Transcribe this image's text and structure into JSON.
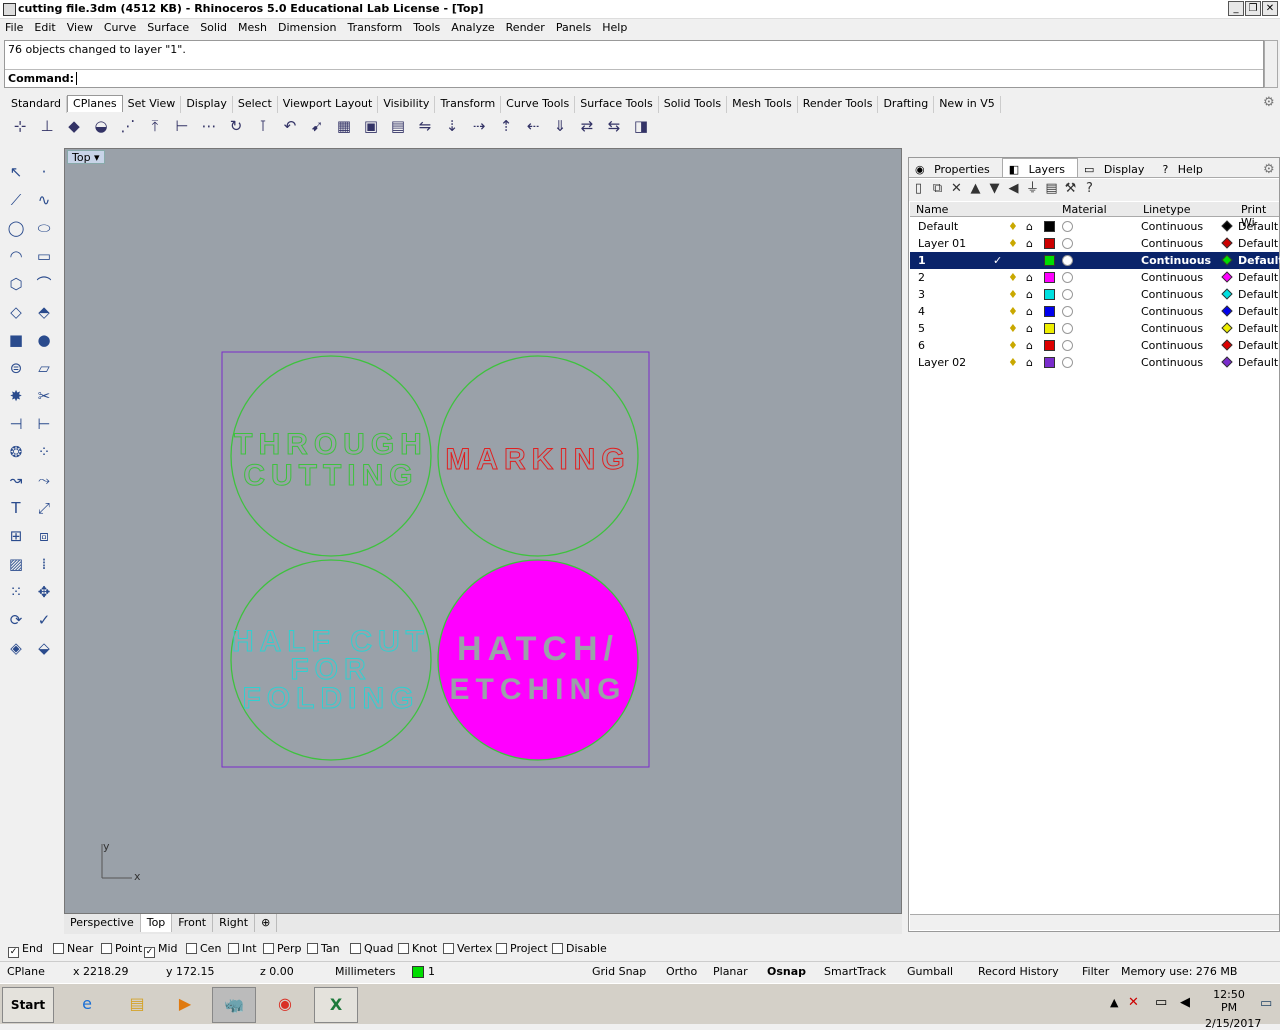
{
  "window": {
    "title": "cutting file.3dm (4512 KB) - Rhinoceros 5.0 Educational Lab License - [Top]"
  },
  "menu": [
    "File",
    "Edit",
    "View",
    "Curve",
    "Surface",
    "Solid",
    "Mesh",
    "Dimension",
    "Transform",
    "Tools",
    "Analyze",
    "Render",
    "Panels",
    "Help"
  ],
  "command": {
    "history": "76 objects changed to layer \"1\".",
    "prompt": "Command:"
  },
  "toolbar_tabs": [
    "Standard",
    "CPlanes",
    "Set View",
    "Display",
    "Select",
    "Viewport Layout",
    "Visibility",
    "Transform",
    "Curve Tools",
    "Surface Tools",
    "Solid Tools",
    "Mesh Tools",
    "Render Tools",
    "Drafting",
    "New in V5"
  ],
  "viewport": {
    "label": "Top",
    "axis_y": "y",
    "axis_x": "x",
    "texts": {
      "through1": "THROUGH",
      "through2": "CUTTING",
      "marking": "MARKING",
      "half1": "HALF CUT",
      "half2": "FOR",
      "half3": "FOLDING",
      "hatch1": "HATCH/",
      "hatch2": "ETCHING"
    },
    "colors": {
      "green": "#3ec23e",
      "red": "#e02020",
      "cyan": "#30d0d0",
      "magenta": "#ff00ff",
      "purple": "#7a2ccc"
    }
  },
  "viewport_tabs": [
    "Perspective",
    "Top",
    "Front",
    "Right"
  ],
  "panel": {
    "tabs": [
      "Properties",
      "Layers",
      "Display",
      "Help"
    ],
    "columns": {
      "name": "Name",
      "material": "Material",
      "linetype": "Linetype",
      "print": "Print Wi"
    },
    "layers": [
      {
        "name": "Default",
        "color": "#000000",
        "linetype": "Continuous",
        "print": "Default",
        "current": false
      },
      {
        "name": "Layer 01",
        "color": "#cc0000",
        "linetype": "Continuous",
        "print": "Default",
        "current": false
      },
      {
        "name": "1",
        "color": "#00dd00",
        "linetype": "Continuous",
        "print": "Default",
        "current": true
      },
      {
        "name": "2",
        "color": "#ff00ff",
        "linetype": "Continuous",
        "print": "Default",
        "current": false
      },
      {
        "name": "3",
        "color": "#00e0e0",
        "linetype": "Continuous",
        "print": "Default",
        "current": false
      },
      {
        "name": "4",
        "color": "#0000ee",
        "linetype": "Continuous",
        "print": "Default",
        "current": false
      },
      {
        "name": "5",
        "color": "#eeee00",
        "linetype": "Continuous",
        "print": "Default",
        "current": false
      },
      {
        "name": "6",
        "color": "#dd0000",
        "linetype": "Continuous",
        "print": "Default",
        "current": false
      },
      {
        "name": "Layer 02",
        "color": "#7a2ccc",
        "linetype": "Continuous",
        "print": "Default",
        "current": false
      }
    ]
  },
  "osnap": [
    {
      "label": "End",
      "checked": true
    },
    {
      "label": "Near",
      "checked": false
    },
    {
      "label": "Point",
      "checked": false
    },
    {
      "label": "Mid",
      "checked": true
    },
    {
      "label": "Cen",
      "checked": false
    },
    {
      "label": "Int",
      "checked": false
    },
    {
      "label": "Perp",
      "checked": false
    },
    {
      "label": "Tan",
      "checked": false
    },
    {
      "label": "Quad",
      "checked": false
    },
    {
      "label": "Knot",
      "checked": false
    },
    {
      "label": "Vertex",
      "checked": false
    },
    {
      "label": "Project",
      "checked": false
    },
    {
      "label": "Disable",
      "checked": false
    }
  ],
  "status": {
    "cplane": "CPlane",
    "x": "x 2218.29",
    "y": "y 172.15",
    "z": "z 0.00",
    "units": "Millimeters",
    "layer": "1",
    "grid_snap": "Grid Snap",
    "ortho": "Ortho",
    "planar": "Planar",
    "osnap": "Osnap",
    "smarttrack": "SmartTrack",
    "gumball": "Gumball",
    "record_history": "Record History",
    "filter": "Filter",
    "memory": "Memory use: 276 MB"
  },
  "taskbar": {
    "start": "Start",
    "time": "12:50 PM",
    "date": "2/15/2017"
  }
}
